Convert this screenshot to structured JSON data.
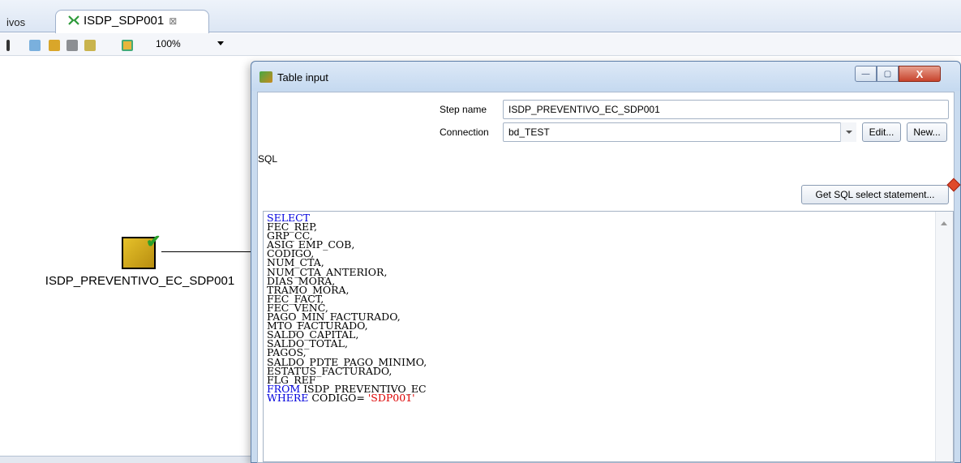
{
  "editor": {
    "prev_tab_label": "ivos",
    "active_tab_label": "ISDP_SDP001",
    "tab_close": "⊠",
    "zoom_value": "100%",
    "step_label": "ISDP_PREVENTIVO_EC_SDP001"
  },
  "dialog": {
    "title": "Table input",
    "min": "—",
    "max": "▢",
    "close": "X",
    "step_name_label": "Step name",
    "step_name_value": "ISDP_PREVENTIVO_EC_SDP001",
    "connection_label": "Connection",
    "connection_value": "bd_TEST",
    "edit_button": "Edit...",
    "new_button": "New...",
    "sql_label": "SQL",
    "get_sql_button": "Get SQL select statement...",
    "sql": {
      "select": "SELECT",
      "columns": "FEC_REP,\nGRP_CC,\nASIG_EMP_COB,\nCODIGO,\nNUM_CTA,\nNUM_CTA_ANTERIOR,\nDIAS_MORA,\nTRAMO_MORA,\nFEC_FACT,\nFEC_VENC,\nPAGO_MIN_FACTURADO,\nMTO_FACTURADO,\nSALDO_CAPITAL,\nSALDO_TOTAL,\nPAGOS,\nSALDO_PDTE_PAGO_MINIMO,\nESTATUS_FACTURADO,\nFLG_REF",
      "from_kw": "FROM",
      "from_rest": " ISDP_PREVENTIVO_EC",
      "where_kw": "WHERE",
      "where_rest": " CODIGO= ",
      "where_value": "'SDP001'"
    }
  },
  "colors": {
    "keyword": "#0000dd",
    "string": "#dd0000",
    "titlebar": "#c5d9f0"
  }
}
